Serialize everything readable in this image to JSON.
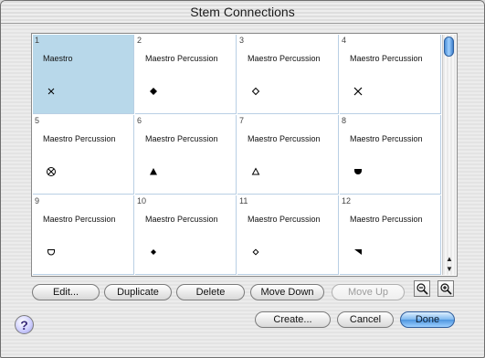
{
  "window": {
    "title": "Stem Connections"
  },
  "grid": {
    "cells": [
      {
        "number": "1",
        "name": "Maestro",
        "icon": "x-notehead-icon"
      },
      {
        "number": "2",
        "name": "Maestro Percussion",
        "icon": "filled-diamond-notehead-icon"
      },
      {
        "number": "3",
        "name": "Maestro Percussion",
        "icon": "open-diamond-notehead-icon"
      },
      {
        "number": "4",
        "name": "Maestro Percussion",
        "icon": "x-notehead-icon"
      },
      {
        "number": "5",
        "name": "Maestro Percussion",
        "icon": "circled-x-notehead-icon"
      },
      {
        "number": "6",
        "name": "Maestro Percussion",
        "icon": "filled-triangle-notehead-icon"
      },
      {
        "number": "7",
        "name": "Maestro Percussion",
        "icon": "open-triangle-notehead-icon"
      },
      {
        "number": "8",
        "name": "Maestro Percussion",
        "icon": "filled-half-circle-notehead-icon"
      },
      {
        "number": "9",
        "name": "Maestro Percussion",
        "icon": "open-half-circle-notehead-icon"
      },
      {
        "number": "10",
        "name": "Maestro Percussion",
        "icon": "small-filled-diamond-notehead-icon"
      },
      {
        "number": "11",
        "name": "Maestro Percussion",
        "icon": "small-open-diamond-notehead-icon"
      },
      {
        "number": "12",
        "name": "Maestro Percussion",
        "icon": "right-triangle-notehead-icon"
      }
    ],
    "selected_index": 0
  },
  "buttons": {
    "edit": "Edit...",
    "duplicate": "Duplicate",
    "delete": "Delete",
    "move_down": "Move Down",
    "move_up": "Move Up",
    "create": "Create...",
    "cancel": "Cancel",
    "done": "Done",
    "help": "?"
  },
  "colors": {
    "selection": "#b8d8ea",
    "grid_line": "#b9cfe4",
    "accent": "#4e95df"
  }
}
